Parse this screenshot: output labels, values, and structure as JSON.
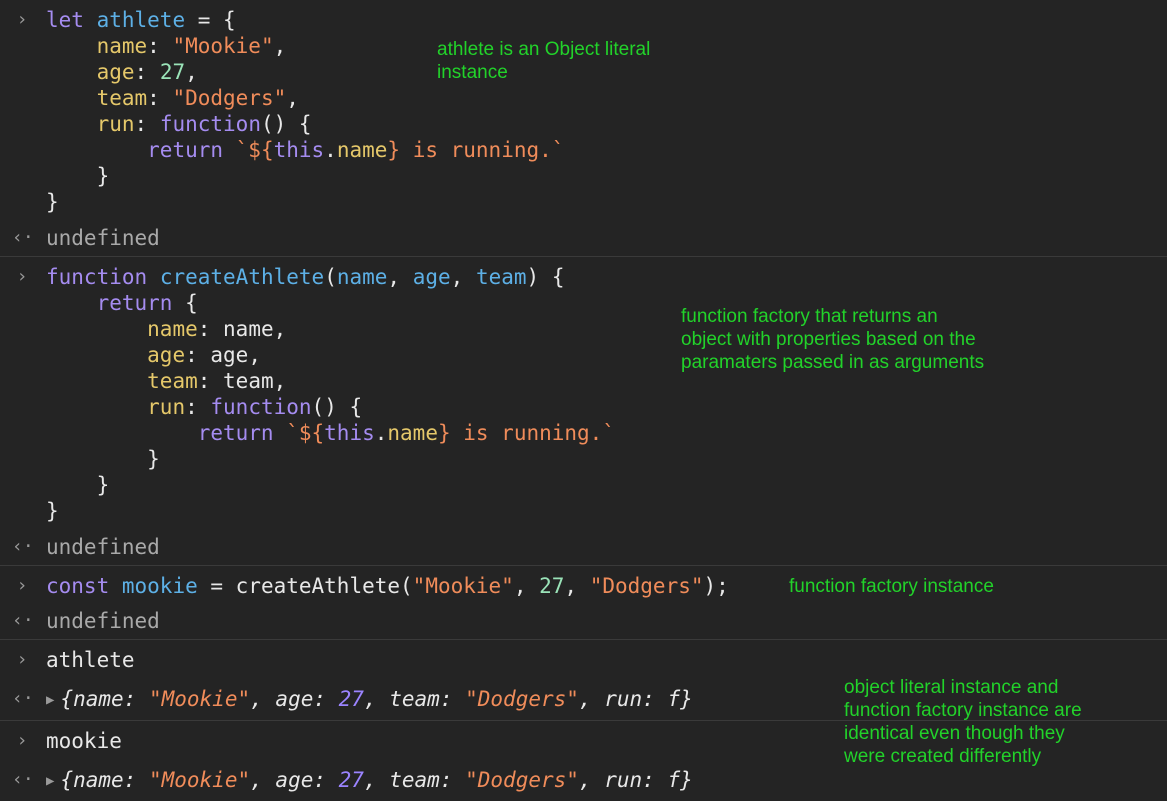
{
  "prompt_symbol": "›",
  "result_symbol": "‹·",
  "expand_symbol": "▶",
  "entry1": {
    "kw_let": "let",
    "var": "athlete",
    "eq": " = {",
    "prop_name": "name",
    "val_name": "\"Mookie\"",
    "prop_age": "age",
    "val_age": "27",
    "prop_team": "team",
    "val_team": "\"Dodgers\"",
    "prop_run": "run",
    "kw_function": "function",
    "fn_tail": "() {",
    "kw_return": "return",
    "tmpl_start": " `${",
    "kw_this": "this",
    "dot": ".",
    "tmpl_prop": "name",
    "tmpl_end": "} is running.`",
    "close_inner": "}",
    "close_outer": "}",
    "result": "undefined",
    "note": "athlete is an Object literal\ninstance"
  },
  "entry2": {
    "kw_function": "function",
    "fn_name": "createAthlete",
    "p_open": "(",
    "p_name": "name",
    "p_age": "age",
    "p_team": "team",
    "p_close": ") {",
    "kw_return": "return",
    "brace": " {",
    "prop_name": "name",
    "val_name": "name",
    "prop_age": "age",
    "val_age": "age",
    "prop_team": "team",
    "val_team": "team",
    "prop_run": "run",
    "kw_function2": "function",
    "fn_tail": "() {",
    "kw_return2": "return",
    "tmpl_start": " `${",
    "kw_this": "this",
    "dot": ".",
    "tmpl_prop": "name",
    "tmpl_end": "} is running.`",
    "close_run": "}",
    "close_obj": "}",
    "close_fn": "}",
    "result": "undefined",
    "note": "function factory that returns an\nobject with properties based on the\nparamaters passed in as arguments"
  },
  "entry3": {
    "kw_const": "const",
    "var": "mookie",
    "eq": " = createAthlete(",
    "arg1": "\"Mookie\"",
    "comma1": ", ",
    "arg2": "27",
    "comma2": ", ",
    "arg3": "\"Dodgers\"",
    "tail": ");",
    "result": "undefined",
    "note": "function factory instance"
  },
  "entry4": {
    "input": "athlete",
    "o_open": "{",
    "k_name": "name",
    "v_name": "\"Mookie\"",
    "k_age": "age",
    "v_age": "27",
    "k_team": "team",
    "v_team": "\"Dodgers\"",
    "k_run": "run",
    "v_run": "f",
    "o_close": "}"
  },
  "entry5": {
    "input": "mookie",
    "o_open": "{",
    "k_name": "name",
    "v_name": "\"Mookie\"",
    "k_age": "age",
    "v_age": "27",
    "k_team": "team",
    "v_team": "\"Dodgers\"",
    "k_run": "run",
    "v_run": "f",
    "o_close": "}"
  },
  "note_bottom": "object literal instance and\nfunction factory instance are\nidentical even though they\nwere created differently"
}
